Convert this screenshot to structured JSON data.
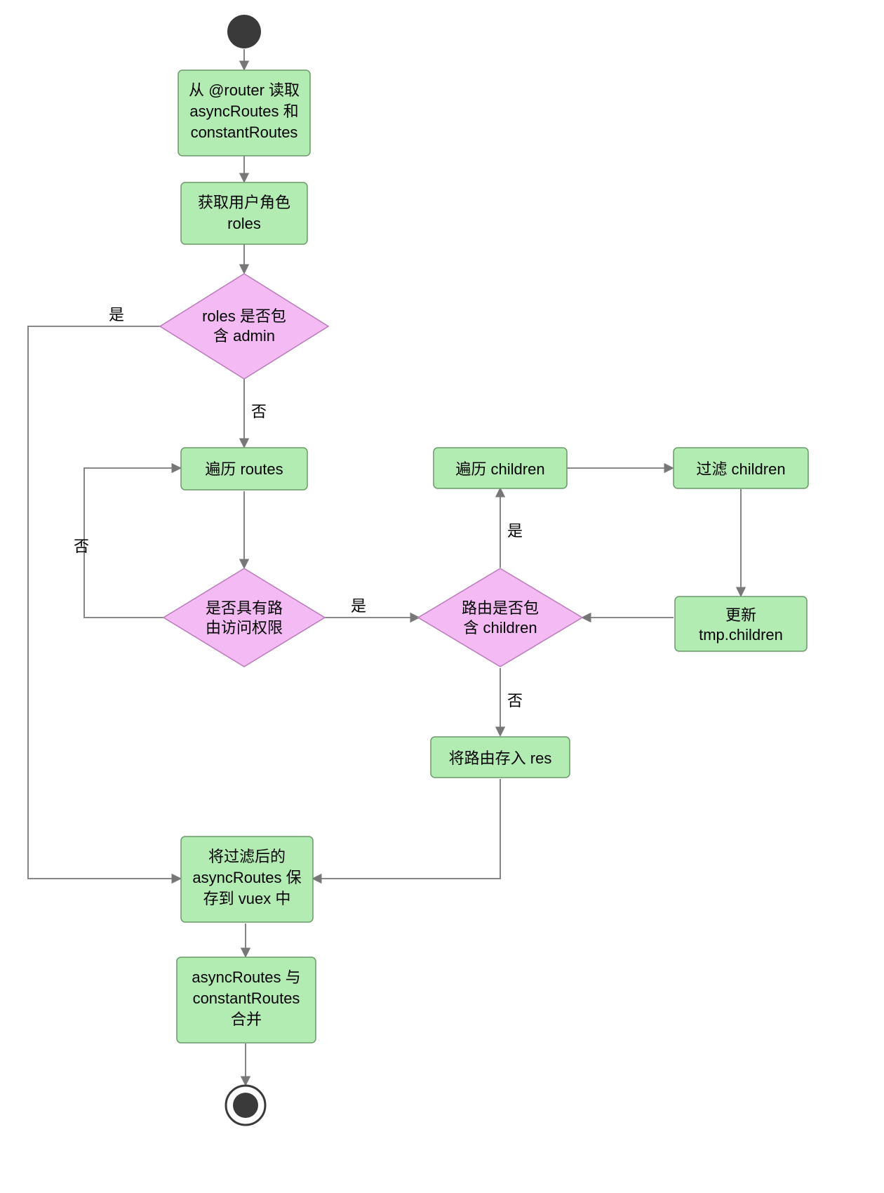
{
  "nodes": {
    "start": {
      "type": "start"
    },
    "readRouter": {
      "type": "process",
      "lines": [
        "从 @router 读取",
        "asyncRoutes 和",
        "constantRoutes"
      ]
    },
    "getRoles": {
      "type": "process",
      "lines": [
        "获取用户角色",
        "roles"
      ]
    },
    "hasAdmin": {
      "type": "decision",
      "lines": [
        "roles 是否包",
        "含 admin"
      ]
    },
    "iterateRoutes": {
      "type": "process",
      "lines": [
        "遍历 routes"
      ]
    },
    "hasPermission": {
      "type": "decision",
      "lines": [
        "是否具有路",
        "由访问权限"
      ]
    },
    "hasChildren": {
      "type": "decision",
      "lines": [
        "路由是否包",
        "含 children"
      ]
    },
    "iterateChildren": {
      "type": "process",
      "lines": [
        "遍历 children"
      ]
    },
    "filterChildren": {
      "type": "process",
      "lines": [
        "过滤 children"
      ]
    },
    "updateTmp": {
      "type": "process",
      "lines": [
        "更新",
        "tmp.children"
      ]
    },
    "pushRes": {
      "type": "process",
      "lines": [
        "将路由存入 res"
      ]
    },
    "saveVuex": {
      "type": "process",
      "lines": [
        "将过滤后的",
        "asyncRoutes 保",
        "存到 vuex 中"
      ]
    },
    "merge": {
      "type": "process",
      "lines": [
        "asyncRoutes  与",
        "constantRoutes",
        "合并"
      ]
    },
    "end": {
      "type": "end"
    }
  },
  "edges": {
    "e_start_readRouter": "",
    "e_readRouter_getRoles": "",
    "e_getRoles_hasAdmin": "",
    "e_hasAdmin_iterateRoutes": "否",
    "e_hasAdmin_saveVuex": "是",
    "e_iterateRoutes_hasPermission": "",
    "e_hasPermission_iterateRoutes": "否",
    "e_hasPermission_hasChildren": "是",
    "e_hasChildren_iterateChildren": "是",
    "e_iterateChildren_filterChildren": "",
    "e_filterChildren_updateTmp": "",
    "e_updateTmp_hasChildren": "",
    "e_hasChildren_pushRes": "否",
    "e_pushRes_saveVuex": "",
    "e_saveVuex_merge": "",
    "e_merge_end": ""
  },
  "colors": {
    "process_fill": "#b3ecb3",
    "process_stroke": "#6a9a6a",
    "decision_fill": "#f4baf4",
    "decision_stroke": "#b87bb8",
    "edge_stroke": "#777",
    "start_fill": "#3a3a3a"
  }
}
